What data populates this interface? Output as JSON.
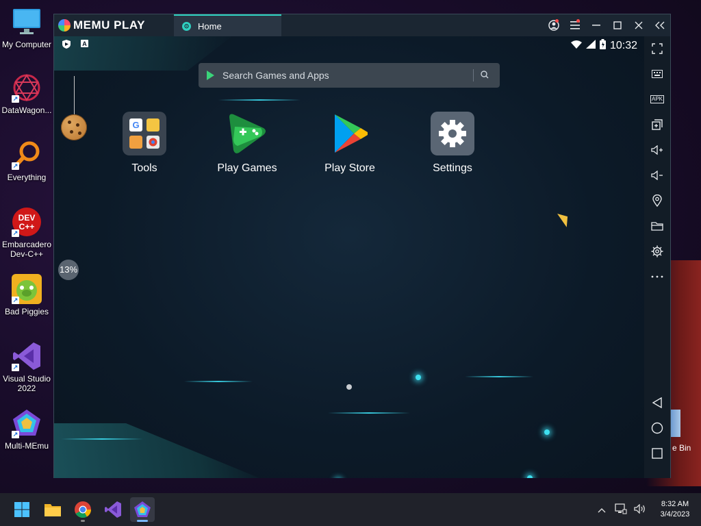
{
  "desktop": {
    "icons": [
      {
        "label": "My Computer"
      },
      {
        "label": "DataWagon..."
      },
      {
        "label": "Everything"
      },
      {
        "label": "Embarcadero Dev-C++"
      },
      {
        "label": "Bad Piggies"
      },
      {
        "label": "Visual Studio 2022"
      },
      {
        "label": "Multi-MEmu"
      }
    ],
    "recycle_bin_label": "e Bin"
  },
  "emulator": {
    "logo_text": "MEMU PLAY",
    "tab_label": "Home",
    "status_time": "10:32",
    "search_placeholder": "Search Games and Apps",
    "apps": [
      {
        "name": "Tools",
        "icon": "tools-folder-icon"
      },
      {
        "name": "Play Games",
        "icon": "play-games-icon"
      },
      {
        "name": "Play Store",
        "icon": "play-store-icon"
      },
      {
        "name": "Settings",
        "icon": "settings-gear-icon"
      }
    ],
    "progress_text": "13%",
    "sidebar_tools": [
      "fullscreen-icon",
      "keyboard-icon",
      "apk-icon",
      "multi-window-icon",
      "volume-up-icon",
      "volume-down-icon",
      "location-icon",
      "folder-icon",
      "gear-icon",
      "more-icon",
      "back-icon",
      "home-icon",
      "recents-icon"
    ],
    "sidebar_apk_label": "APK",
    "colors": {
      "accent": "#2fd0c0",
      "play_green": "#3bd47a"
    }
  },
  "taskbar": {
    "clock_time": "8:32 AM",
    "clock_date": "3/4/2023"
  }
}
